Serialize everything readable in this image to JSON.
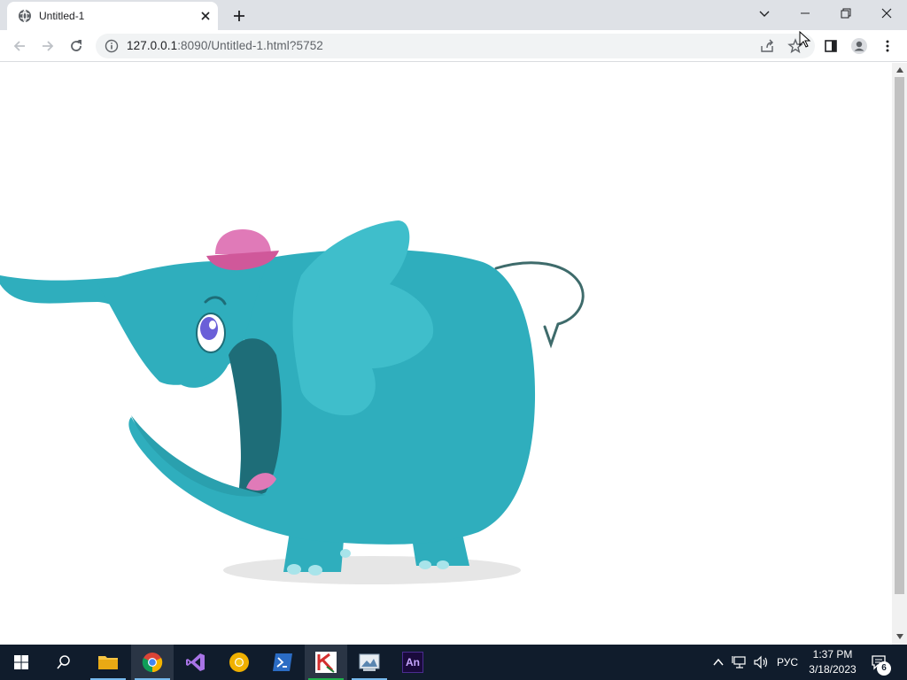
{
  "browser": {
    "tab": {
      "title": "Untitled-1"
    },
    "address": {
      "host": "127.0.0.1",
      "rest": ":8090/Untitled-1.html?5752"
    }
  },
  "illustration": {
    "subject": "cartoon-elephant",
    "colors": {
      "body": "#2faebd",
      "ear": "#3fbecb",
      "mouth": "#1e6d78",
      "tongue": "#e07ab8",
      "hat": "#e07ab8",
      "hat_brim": "#d0589a",
      "eye": "#6a5fd8",
      "shadow": "#e6e6e6",
      "tail": "#3e6b6b",
      "toes": "#a8e4ea"
    }
  },
  "taskbar": {
    "apps": [
      {
        "name": "file-explorer",
        "active": false
      },
      {
        "name": "chrome",
        "active": true
      },
      {
        "name": "visual-studio",
        "active": false
      },
      {
        "name": "chrome-canary",
        "active": false
      },
      {
        "name": "powershell",
        "active": false
      },
      {
        "name": "kleopatra",
        "active": true
      },
      {
        "name": "screenshot-tool",
        "active": false
      },
      {
        "name": "animate",
        "active": false,
        "label": "An"
      }
    ],
    "tray": {
      "language": "РУС",
      "time": "1:37 PM",
      "date": "3/18/2023",
      "notifications": "6"
    }
  }
}
